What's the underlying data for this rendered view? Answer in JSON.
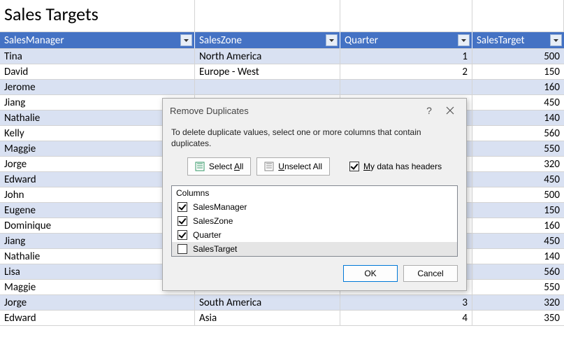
{
  "title": "Sales Targets",
  "headers": {
    "a": "SalesManager",
    "b": "SalesZone",
    "c": "Quarter",
    "d": "SalesTarget"
  },
  "rows": [
    {
      "a": "Tina",
      "b": "North America",
      "c": "1",
      "d": "500"
    },
    {
      "a": "David",
      "b": "Europe - West",
      "c": "2",
      "d": "150"
    },
    {
      "a": "Jerome",
      "b": "",
      "c": "",
      "d": "160"
    },
    {
      "a": "Jiang",
      "b": "",
      "c": "",
      "d": "450"
    },
    {
      "a": "Nathalie",
      "b": "",
      "c": "",
      "d": "140"
    },
    {
      "a": "Kelly",
      "b": "",
      "c": "",
      "d": "560"
    },
    {
      "a": "Maggie",
      "b": "",
      "c": "",
      "d": "550"
    },
    {
      "a": "Jorge",
      "b": "",
      "c": "",
      "d": "320"
    },
    {
      "a": "Edward",
      "b": "",
      "c": "",
      "d": "450"
    },
    {
      "a": "John",
      "b": "",
      "c": "",
      "d": "500"
    },
    {
      "a": "Eugene",
      "b": "",
      "c": "",
      "d": "150"
    },
    {
      "a": "Dominique",
      "b": "",
      "c": "",
      "d": "160"
    },
    {
      "a": "Jiang",
      "b": "",
      "c": "",
      "d": "450"
    },
    {
      "a": "Nathalie",
      "b": "",
      "c": "",
      "d": "140"
    },
    {
      "a": "Lisa",
      "b": "",
      "c": "",
      "d": "560"
    },
    {
      "a": "Maggie",
      "b": "",
      "c": "",
      "d": "550"
    },
    {
      "a": "Jorge",
      "b": "South America",
      "c": "3",
      "d": "320"
    },
    {
      "a": "Edward",
      "b": "Asia",
      "c": "4",
      "d": "350"
    }
  ],
  "dialog": {
    "title": "Remove Duplicates",
    "desc": "To delete duplicate values, select one or more columns that contain duplicates.",
    "selectAll_pre": "Select ",
    "selectAll_u": "A",
    "selectAll_post": "ll",
    "unselectAll_u": "U",
    "unselectAll_post": "nselect All",
    "headersCheck_u": "M",
    "headersCheck_post": "y data has headers",
    "headersChecked": true,
    "columnsLabel": "Columns",
    "cols": [
      {
        "label": "SalesManager",
        "checked": true,
        "selected": false
      },
      {
        "label": "SalesZone",
        "checked": true,
        "selected": false
      },
      {
        "label": "Quarter",
        "checked": true,
        "selected": false
      },
      {
        "label": "SalesTarget",
        "checked": false,
        "selected": true
      }
    ],
    "ok": "OK",
    "cancel": "Cancel"
  }
}
